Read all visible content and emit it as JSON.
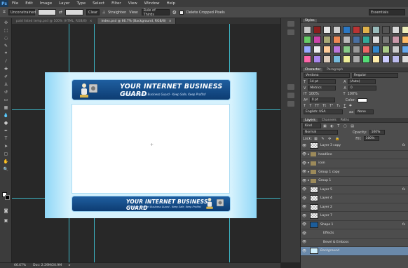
{
  "app": {
    "logo": "Ps"
  },
  "menu": [
    "File",
    "Edit",
    "Image",
    "Layer",
    "Type",
    "Select",
    "Filter",
    "View",
    "Window",
    "Help"
  ],
  "options": {
    "ratio": "Unconstrained",
    "clear": "Clear",
    "straighten": "Straighten",
    "view_label": "View:",
    "view_value": "Rule of Thirds",
    "delete_cropped": "Delete Cropped Pixels",
    "workspace": "Essentials"
  },
  "tabs": [
    {
      "label": "paid listed temp.psd @ 100% (HTML, RGB/8)",
      "active": false
    },
    {
      "label": "index.psd @ 66.7% (Background, RGB/8)",
      "active": true
    }
  ],
  "banner_top": {
    "title": "YOUR INTERNET BUSINESS GUARD",
    "subtitle": "Ultimate Internet Business Guard - Keep Safe, Keep Profits!"
  },
  "banner_bottom": {
    "title": "YOUR INTERNET BUSINESS GUARD",
    "subtitle": "Ultimate Internet Business Guard - Keep Safe, Keep Profits!"
  },
  "status": {
    "zoom": "66.67%",
    "doc": "Doc: 2.29M/20.9M"
  },
  "styles_panel": {
    "title": "Styles"
  },
  "character_panel": {
    "tab1": "Character",
    "tab2": "Paragraph",
    "font": "Verdana",
    "style": "Regular",
    "size": "14 pt",
    "leading": "(Auto)",
    "kerning": "Metrics",
    "tracking": "0",
    "vscale": "100%",
    "hscale": "100%",
    "baseline": "0 pt",
    "color_label": "Color:",
    "language": "English: USA",
    "aa_icon": "aa",
    "aa": "None"
  },
  "layers_panel": {
    "tabs": [
      "Layers",
      "Channels",
      "Paths"
    ],
    "kind": "Kind",
    "blend": "Normal",
    "opacity_label": "Opacity:",
    "opacity": "100%",
    "lock_label": "Lock:",
    "fill_label": "Fill:",
    "fill": "100%",
    "layers": [
      {
        "name": "Layer 3 copy",
        "type": "layer",
        "fx": true
      },
      {
        "name": "headline",
        "type": "folder"
      },
      {
        "name": "icon",
        "type": "folder"
      },
      {
        "name": "Group 1 copy",
        "type": "folder"
      },
      {
        "name": "Group 1",
        "type": "folder"
      },
      {
        "name": "Layer 5",
        "type": "layer",
        "fx": true
      },
      {
        "name": "Layer 4",
        "type": "layer"
      },
      {
        "name": "Layer 2",
        "type": "layer"
      },
      {
        "name": "Layer 7",
        "type": "layer"
      },
      {
        "name": "Shape 1",
        "type": "layer",
        "fx": true
      },
      {
        "name": "Effects",
        "type": "effect"
      },
      {
        "name": "Bevel & Emboss",
        "type": "effect"
      },
      {
        "name": "Background",
        "type": "layer",
        "selected": true
      }
    ]
  },
  "colors": {
    "accent": "#3db8c8",
    "selection": "#6a89aa"
  }
}
